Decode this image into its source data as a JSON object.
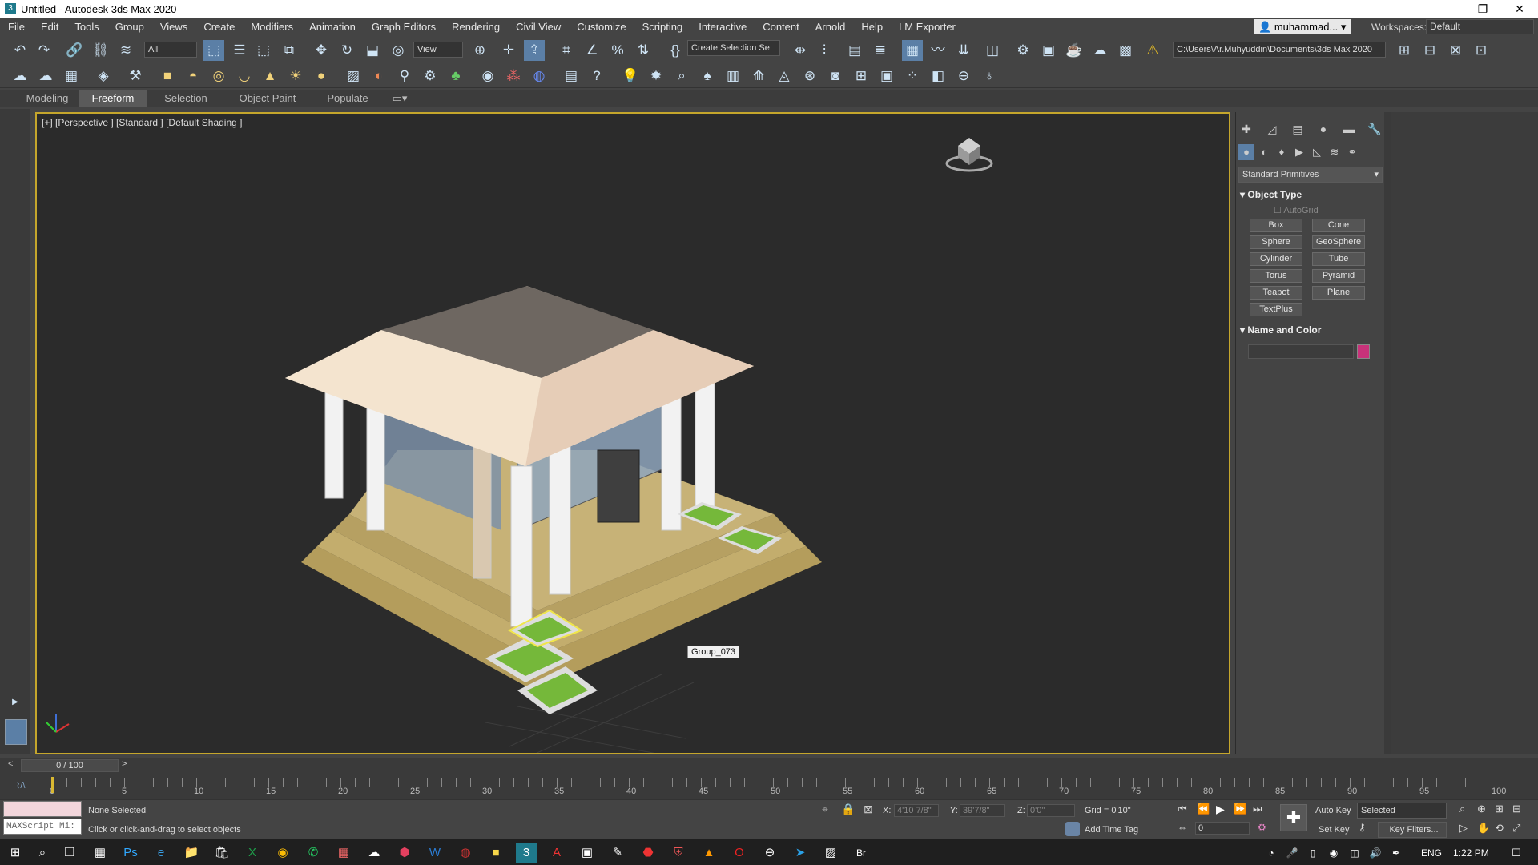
{
  "window": {
    "title": "Untitled - Autodesk 3ds Max 2020",
    "minimize": "–",
    "maximize": "❐",
    "close": "✕"
  },
  "menu": [
    "File",
    "Edit",
    "Tools",
    "Group",
    "Views",
    "Create",
    "Modifiers",
    "Animation",
    "Graph Editors",
    "Rendering",
    "Civil View",
    "Customize",
    "Scripting",
    "Interactive",
    "Content",
    "Arnold",
    "Help",
    "LM Exporter"
  ],
  "user": {
    "name": "muhammad...",
    "caret": "▾"
  },
  "workspace": {
    "label": "Workspaces:",
    "value": "Default"
  },
  "toolbar": {
    "filter": "All",
    "refcoord": "View",
    "selection_set": "Create Selection Se",
    "project_path": "C:\\Users\\Ar.Muhyuddin\\Documents\\3ds Max 2020"
  },
  "ribbon": {
    "tabs": [
      "Modeling",
      "Freeform",
      "Selection",
      "Object Paint",
      "Populate"
    ],
    "active": "Freeform"
  },
  "viewport": {
    "label": "[+] [Perspective ] [Standard ] [Default Shading ]",
    "tooltip": "Group_073"
  },
  "command_panel": {
    "category": "Standard Primitives",
    "object_type_title": "Object Type",
    "autogrid": "AutoGrid",
    "buttons": [
      "Box",
      "Cone",
      "Sphere",
      "GeoSphere",
      "Cylinder",
      "Tube",
      "Torus",
      "Pyramid",
      "Teapot",
      "Plane",
      "TextPlus"
    ],
    "name_color_title": "Name and Color",
    "color": "#c8327a"
  },
  "timeline": {
    "frame": "0 / 100",
    "ticks": [
      "0",
      "5",
      "10",
      "15",
      "20",
      "25",
      "30",
      "35",
      "40",
      "45",
      "50",
      "55",
      "60",
      "65",
      "70",
      "75",
      "80",
      "85",
      "90",
      "95",
      "100"
    ],
    "prev": "<",
    "next": ">"
  },
  "status": {
    "maxscript": "MAXScript Mi:",
    "selection": "None Selected",
    "prompt": "Click or click-and-drag to select objects",
    "x_label": "X:",
    "x_value": "4'10 7/8\"",
    "y_label": "Y:",
    "y_value": "39'7/8\"",
    "z_label": "Z:",
    "z_value": "0'0\"",
    "grid": "Grid = 0'10\"",
    "add_time_tag": "Add Time Tag",
    "auto_key": "Auto Key",
    "set_key": "Set Key",
    "selected": "Selected",
    "key_filters": "Key Filters...",
    "frame_field": "0"
  },
  "taskbar": {
    "lang": "ENG",
    "time": "1:22 PM"
  }
}
